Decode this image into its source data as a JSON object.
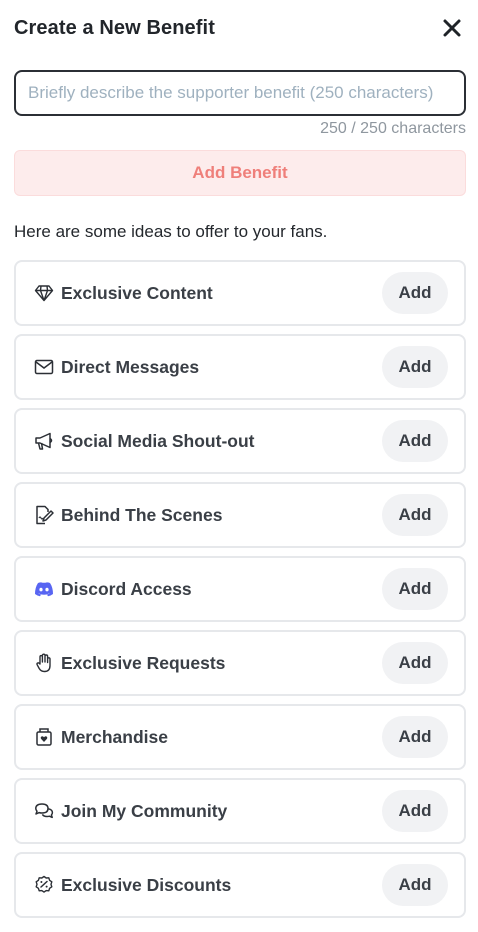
{
  "header": {
    "title": "Create a New Benefit"
  },
  "form": {
    "placeholder": "Briefly describe the supporter benefit (250 characters)",
    "value": "",
    "char_count": "250 / 250 characters",
    "add_label": "Add Benefit"
  },
  "ideas": {
    "intro": "Here are some ideas to offer to your fans.",
    "items": [
      {
        "label": "Exclusive Content",
        "icon": "diamond-icon",
        "add_label": "Add"
      },
      {
        "label": "Direct Messages",
        "icon": "envelope-icon",
        "add_label": "Add"
      },
      {
        "label": "Social Media Shout-out",
        "icon": "megaphone-icon",
        "add_label": "Add"
      },
      {
        "label": "Behind The Scenes",
        "icon": "document-pen-icon",
        "add_label": "Add"
      },
      {
        "label": "Discord Access",
        "icon": "discord-icon",
        "add_label": "Add"
      },
      {
        "label": "Exclusive Requests",
        "icon": "hand-icon",
        "add_label": "Add"
      },
      {
        "label": "Merchandise",
        "icon": "gift-box-icon",
        "add_label": "Add"
      },
      {
        "label": "Join My Community",
        "icon": "chat-bubbles-icon",
        "add_label": "Add"
      },
      {
        "label": "Exclusive Discounts",
        "icon": "discount-badge-icon",
        "add_label": "Add"
      }
    ]
  },
  "colors": {
    "accent": "#ef7f7a",
    "accent_bg": "#fdecec",
    "discord": "#5865f2"
  }
}
